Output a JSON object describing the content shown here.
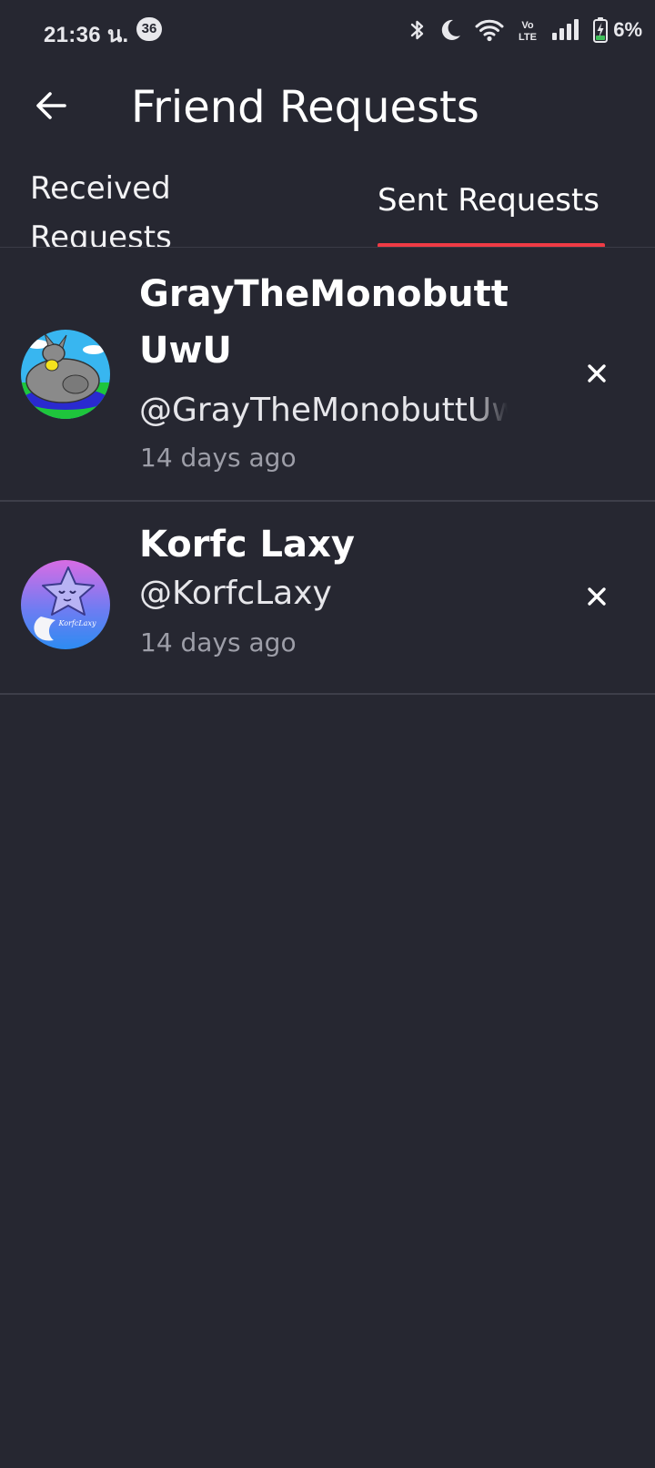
{
  "status_bar": {
    "time": "21:36 น.",
    "notification_count": "36",
    "battery_percent": "6%",
    "network_label": "Vo LTE",
    "icons": [
      "bluetooth-icon",
      "moon-icon",
      "wifi-icon",
      "volte-icon",
      "signal-icon",
      "battery-charging-icon"
    ]
  },
  "header": {
    "back_icon": "arrow-left-icon",
    "title": "Friend Requests"
  },
  "tabs": {
    "received": "Received Requests",
    "sent": "Sent Requests",
    "active": "sent",
    "indicator_color": "#ef3b45"
  },
  "requests": [
    {
      "display_name": "GrayTheMonobutt UwU",
      "username": "@GrayTheMonobuttUwU",
      "time_ago": "14 days ago",
      "avatar_icon": "gray-creature-avatar",
      "action_icon": "close-icon"
    },
    {
      "display_name": "Korfc Laxy",
      "username": "@KorfcLaxy",
      "time_ago": "14 days ago",
      "avatar_icon": "star-character-avatar",
      "avatar_text": "KorfcLaxy",
      "action_icon": "close-icon"
    }
  ],
  "colors": {
    "background": "#262731",
    "accent": "#ef3b45",
    "secondary_text": "#9d9ea8"
  }
}
